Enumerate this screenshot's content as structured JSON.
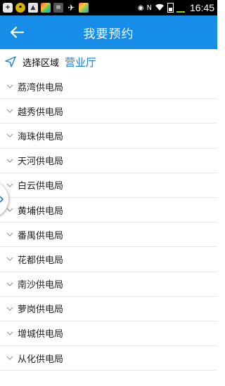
{
  "status_bar": {
    "clock": "16:45",
    "left_icons": [
      "add-icon",
      "coin-icon",
      "image-icon",
      "app-icon",
      "app-icon",
      "pin-icon",
      "app-icon"
    ],
    "right_icons": [
      "eye-icon",
      "nfc-icon",
      "wifi-icon",
      "battery-icon",
      "charging-icon"
    ]
  },
  "app_bar": {
    "title": "我要预约",
    "back_icon": "arrow-left-icon"
  },
  "region": {
    "label": "选择区域",
    "value": "营业厅",
    "icon": "navigation-arrow-icon"
  },
  "bureaus": [
    "荔湾供电局",
    "越秀供电局",
    "海珠供电局",
    "天河供电局",
    "白云供电局",
    "黄埔供电局",
    "番禺供电局",
    "花都供电局",
    "南沙供电局",
    "萝岗供电局",
    "增城供电局",
    "从化供电局"
  ],
  "colors": {
    "app_bar": "#168ee8",
    "region_value": "#1b7ed6",
    "status_bar": "#000000"
  }
}
